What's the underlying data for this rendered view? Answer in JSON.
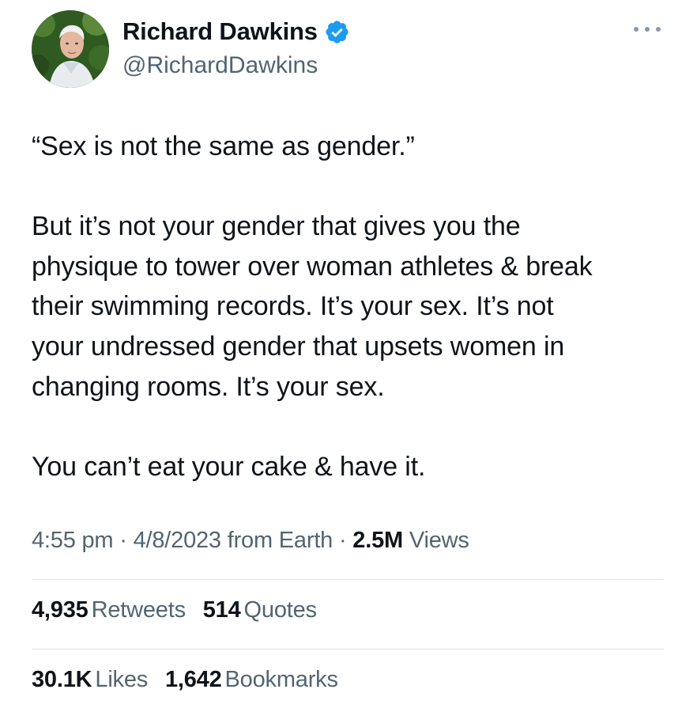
{
  "author": {
    "display_name": "Richard Dawkins",
    "handle": "@RichardDawkins",
    "verified_icon": "verified-badge-icon",
    "badge_color": "#1d9bf0"
  },
  "menu_icon": "more-options-icon",
  "tweet": {
    "lines": [
      "“Sex is not the same as gender.”",
      "",
      "But it’s not your gender that gives you the",
      "physique to tower over woman athletes & break",
      "their swimming records. It’s your sex. It’s not",
      "your undressed gender that upsets women in",
      "changing rooms. It’s your sex.",
      "",
      "You can’t eat your cake & have it."
    ]
  },
  "meta": {
    "time": "4:55 pm",
    "separator": "·",
    "date": "4/8/2023",
    "source": "from Earth",
    "views_count": "2.5M",
    "views_label": "Views"
  },
  "stats": {
    "retweets_count": "4,935",
    "retweets_label": "Retweets",
    "quotes_count": "514",
    "quotes_label": "Quotes",
    "likes_count": "30.1K",
    "likes_label": "Likes",
    "bookmarks_count": "1,642",
    "bookmarks_label": "Bookmarks"
  }
}
